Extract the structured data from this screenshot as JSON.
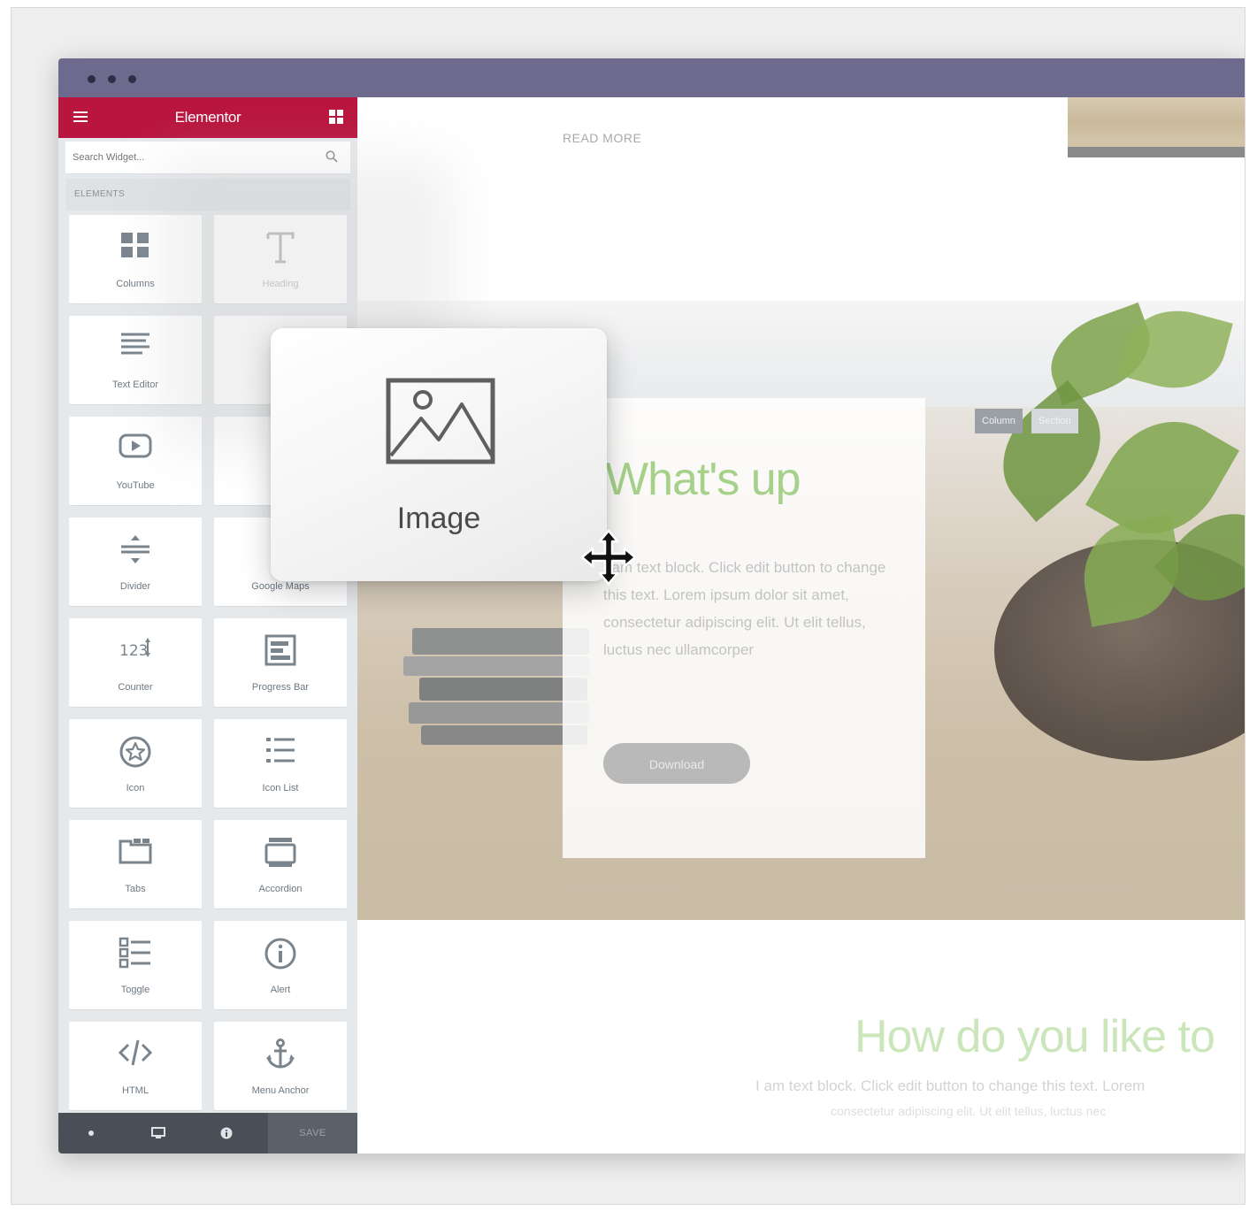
{
  "window": {
    "colors": {
      "titlebar": "#6e6a8e",
      "brand": "#b9163f",
      "footer": "#484f57"
    }
  },
  "sidebar": {
    "title": "Elementor",
    "menu_icon": "hamburger-icon",
    "apps_icon": "grid-icon",
    "search_placeholder": "Search Widget...",
    "section_label": "ELEMENTS",
    "widgets": [
      {
        "label": "Columns",
        "icon": "columns-icon"
      },
      {
        "label": "Heading",
        "icon": "heading-icon"
      },
      {
        "label": "Text Editor",
        "icon": "text-editor-icon"
      },
      {
        "label": "",
        "icon": "image-icon"
      },
      {
        "label": "YouTube",
        "icon": "youtube-icon"
      },
      {
        "label": "",
        "icon": "button-icon"
      },
      {
        "label": "Divider",
        "icon": "divider-icon"
      },
      {
        "label": "Google Maps",
        "icon": "map-icon"
      },
      {
        "label": "Counter",
        "icon": "counter-icon"
      },
      {
        "label": "Progress Bar",
        "icon": "progress-bar-icon"
      },
      {
        "label": "Icon",
        "icon": "star-icon"
      },
      {
        "label": "Icon List",
        "icon": "icon-list-icon"
      },
      {
        "label": "Tabs",
        "icon": "tabs-icon"
      },
      {
        "label": "Accordion",
        "icon": "accordion-icon"
      },
      {
        "label": "Toggle",
        "icon": "toggle-icon"
      },
      {
        "label": "Alert",
        "icon": "alert-icon"
      },
      {
        "label": "HTML",
        "icon": "code-icon"
      },
      {
        "label": "Menu Anchor",
        "icon": "anchor-icon"
      }
    ],
    "footer": {
      "save_label": "SAVE",
      "icons": [
        "close-icon",
        "desktop-icon",
        "info-icon"
      ]
    }
  },
  "canvas": {
    "read_more": "READ MORE",
    "column_tabs": [
      "Column",
      "Section"
    ],
    "card": {
      "heading": "What's up",
      "body": "I am text block. Click edit button to change this text. Lorem ipsum dolor sit amet, consectetur adipiscing elit. Ut elit tellus, luctus nec ullamcorper",
      "button": "Download"
    },
    "headline": "How do you like to",
    "paragraph": "I am text block. Click edit button to change this text. Lorem",
    "paragraph_2": "consectetur adipiscing elit. Ut elit tellus, luctus nec"
  },
  "drag": {
    "label": "Image",
    "icon": "image-icon",
    "cursor": "move-cursor-icon"
  }
}
